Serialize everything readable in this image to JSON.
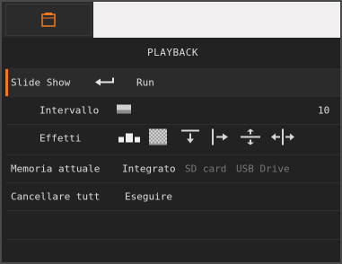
{
  "header": {
    "title": "PLAYBACK"
  },
  "rows": [
    {
      "label": "Slide Show",
      "value": "Run"
    },
    {
      "label": "Intervallo",
      "value": "10"
    },
    {
      "label": "Effetti",
      "effects": [
        "blocks-icon",
        "checker-icon",
        "wipe-down-icon",
        "wipe-right-icon",
        "split-vertical-icon",
        "split-horizontal-icon"
      ]
    },
    {
      "label": "Memoria attuale",
      "options": [
        "Integrato",
        "SD card",
        "USB Drive"
      ],
      "selected": "Integrato"
    },
    {
      "label": "Cancellare tutt",
      "value": "Eseguire"
    }
  ],
  "colors": {
    "accent": "#f07a22",
    "text": "#dcdcdc",
    "muted": "#777777"
  }
}
